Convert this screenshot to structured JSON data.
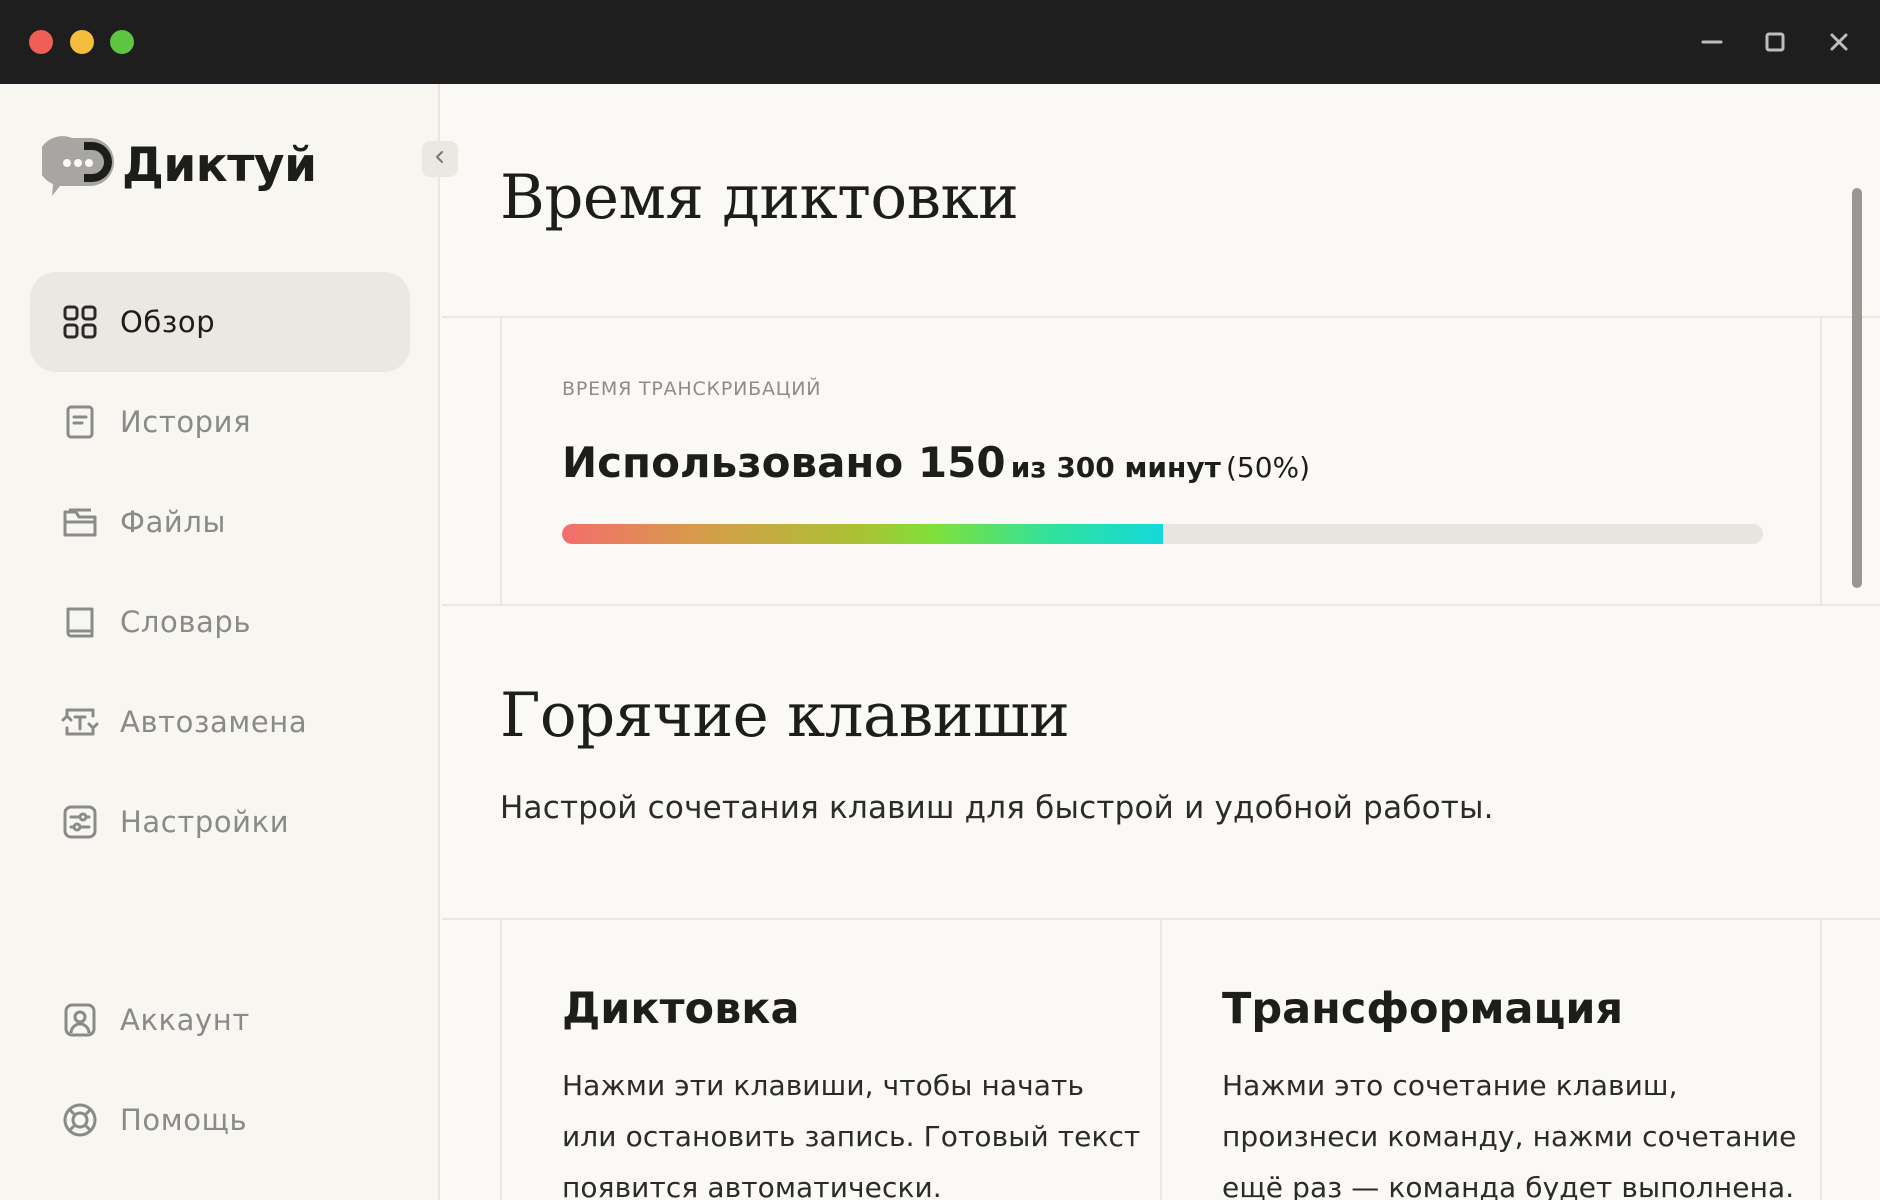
{
  "window": {
    "controls": {
      "minimize": "minimize-icon",
      "maximize": "maximize-icon",
      "close": "close-icon"
    }
  },
  "brand": {
    "name": "Диктуй",
    "logo_icon": "chat-bubble-logo"
  },
  "sidebar": {
    "collapse_icon": "chevron-left-icon",
    "items": [
      {
        "id": "overview",
        "label": "Обзор",
        "icon": "grid-icon",
        "active": true
      },
      {
        "id": "history",
        "label": "История",
        "icon": "document-icon"
      },
      {
        "id": "files",
        "label": "Файлы",
        "icon": "folder-icon"
      },
      {
        "id": "dictionary",
        "label": "Словарь",
        "icon": "book-icon"
      },
      {
        "id": "autoreplace",
        "label": "Автозамена",
        "icon": "text-replace-icon"
      },
      {
        "id": "settings",
        "label": "Настройки",
        "icon": "sliders-icon"
      }
    ],
    "bottom_items": [
      {
        "id": "account",
        "label": "Аккаунт",
        "icon": "user-icon"
      },
      {
        "id": "help",
        "label": "Помощь",
        "icon": "lifebuoy-icon"
      }
    ]
  },
  "usage": {
    "title": "Время диктовки",
    "eyebrow": "ВРЕМЯ ТРАНСКРИБАЦИЙ",
    "used_prefix": "Использовано 150",
    "used_suffix": "из 300 минут",
    "percent_text": "(50%)",
    "used_minutes": 150,
    "total_minutes": 300,
    "fraction": 0.5
  },
  "hotkeys": {
    "title": "Горячие клавиши",
    "subtitle": "Настрой сочетания клавиш для быстрой и удобной работы.",
    "cards": [
      {
        "title": "Диктовка",
        "lines": [
          "Нажми эти клавиши, чтобы начать",
          "или остановить запись. Готовый текст",
          "появится автоматически."
        ]
      },
      {
        "title": "Трансформация",
        "lines": [
          "Нажми это сочетание клавиш,",
          "произнеси команду, нажми сочетание",
          "ещё раз — команда будет выполнена."
        ]
      }
    ]
  }
}
